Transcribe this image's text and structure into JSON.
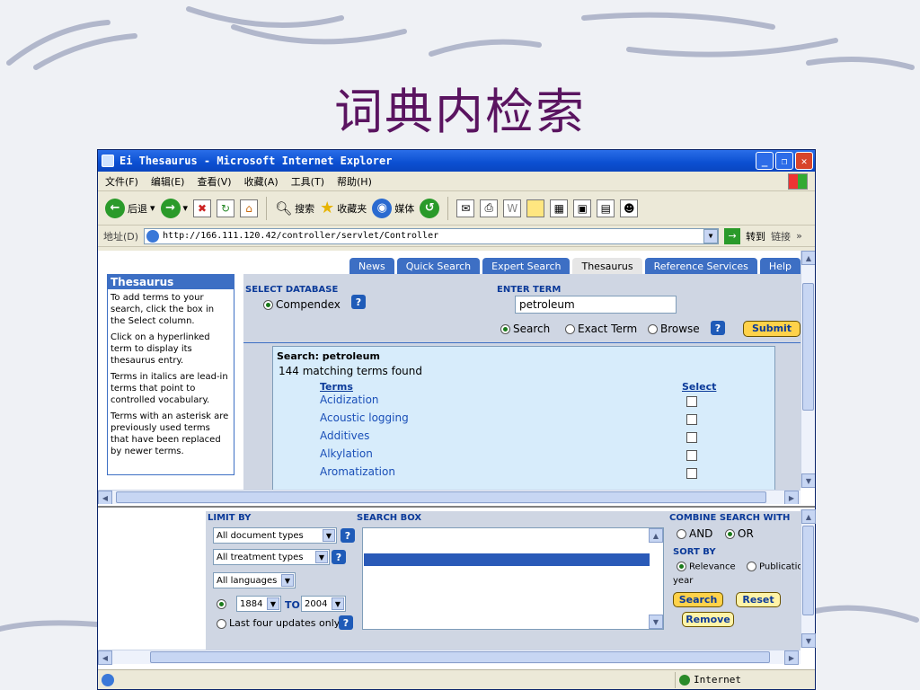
{
  "slide": {
    "title": "词典内检索"
  },
  "window": {
    "title": "Ei Thesaurus - Microsoft Internet Explorer",
    "menu": [
      "文件(F)",
      "编辑(E)",
      "查看(V)",
      "收藏(A)",
      "工具(T)",
      "帮助(H)"
    ],
    "toolbar": {
      "back": "后退",
      "search": "搜索",
      "favorites": "收藏夹",
      "media": "媒体"
    },
    "address_label": "地址(D)",
    "address_url": "http://166.111.120.42/controller/servlet/Controller",
    "go_label": "转到",
    "links_label": "链接",
    "status_zone": "Internet"
  },
  "tabs": [
    "News",
    "Quick Search",
    "Expert Search",
    "Thesaurus",
    "Reference Services",
    "Help"
  ],
  "active_tab": "Thesaurus",
  "sidebar": {
    "title": "Thesaurus",
    "paragraphs": [
      "To add terms to your search, click the box in the Select column.",
      "Click on a hyperlinked term to display its thesaurus entry.",
      "Terms in italics are lead-in terms that point to controlled vocabulary.",
      "Terms with an asterisk are previously used terms that have been replaced by newer terms."
    ]
  },
  "select_database": {
    "label": "SELECT DATABASE",
    "option": "Compendex"
  },
  "enter_term": {
    "label": "ENTER TERM",
    "value": "petroleum",
    "modes": [
      "Search",
      "Exact Term",
      "Browse"
    ],
    "submit": "Submit"
  },
  "results": {
    "search_line": "Search: petroleum",
    "count_line": "144 matching terms found",
    "col_terms": "Terms",
    "col_select": "Select",
    "terms": [
      "Acidization",
      "Acoustic logging",
      "Additives",
      "Alkylation",
      "Aromatization"
    ]
  },
  "limit_by": {
    "label": "LIMIT BY",
    "doc_types": "All document types",
    "treatment_types": "All treatment types",
    "languages": "All languages",
    "year_from": "1884",
    "to_label": "TO",
    "year_to": "2004",
    "last_updates": "Last four updates only"
  },
  "search_box": {
    "label": "SEARCH BOX"
  },
  "combine": {
    "label": "COMBINE SEARCH WITH",
    "and": "AND",
    "or": "OR",
    "sort_label": "SORT BY",
    "relevance": "Relevance",
    "publication": "Publication",
    "year": "year",
    "search_btn": "Search",
    "reset_btn": "Reset",
    "remove_btn": "Remove"
  }
}
